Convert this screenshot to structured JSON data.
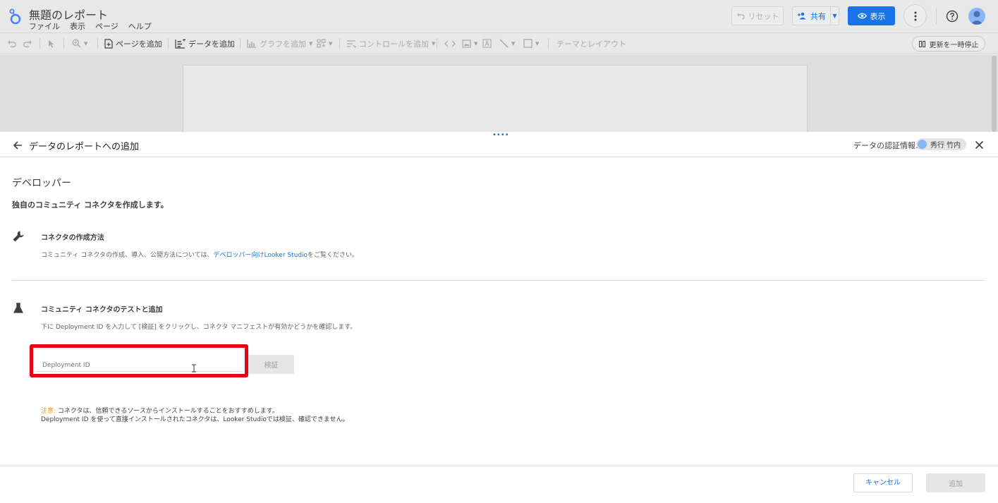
{
  "app": {
    "doc_title": "無題のレポート",
    "menu": [
      "ファイル",
      "表示",
      "ページ",
      "ヘルプ"
    ],
    "reset_label": "リセット",
    "share_label": "共有",
    "view_label": "表示"
  },
  "toolbar": {
    "add_page": "ページを追加",
    "add_data": "データを追加",
    "add_chart": "グラフを追加",
    "add_control": "コントロールを追加",
    "theme_layout": "テーマとレイアウト",
    "pause_updates": "更新を一時停止"
  },
  "panel": {
    "title": "データのレポートへの追加",
    "cred_label": "データの認証情報:",
    "cred_user": "秀行 竹内",
    "section_title": "デベロッパー",
    "section_subtitle": "独自のコミュニティ コネクタを作成します。",
    "howto": {
      "title": "コネクタの作成方法",
      "desc_before": "コミュニティ コネクタの作成、導入、公開方法については、",
      "link": "デベロッパー向けLooker Studio",
      "desc_after": "をご覧ください。"
    },
    "test": {
      "title": "コミュニティ コネクタのテストと追加",
      "desc": "下に Deployment ID を入力して [検証] をクリックし、コネクタ マニフェストが有効かどうかを確認します。",
      "input_placeholder": "Deployment ID",
      "input_value": "",
      "verify_label": "検証"
    },
    "note": {
      "label": "注意:",
      "line1": " コネクタは、信頼できるソースからインストールすることをおすすめします。",
      "line2": "Deployment ID を使って直接インストールされたコネクタは、Looker Studioでは検証、確認できません。"
    },
    "cancel_label": "キャンセル",
    "add_label": "追加"
  },
  "colors": {
    "accent": "#1a73e8",
    "highlight": "#e30613",
    "warning": "#f29900"
  },
  "icons": [
    "looker-studio-logo-icon",
    "undo-icon",
    "redo-icon",
    "select-icon",
    "zoom-icon",
    "add-page-icon",
    "add-data-icon",
    "add-chart-icon",
    "community-viz-icon",
    "control-icon",
    "embed-icon",
    "image-icon",
    "text-icon",
    "line-icon",
    "shape-icon",
    "reset-icon",
    "add-person-icon",
    "eye-icon",
    "more-vert-icon",
    "help-icon",
    "avatar-icon",
    "back-arrow-icon",
    "close-icon",
    "wrench-icon",
    "flask-icon",
    "pause-icon"
  ]
}
